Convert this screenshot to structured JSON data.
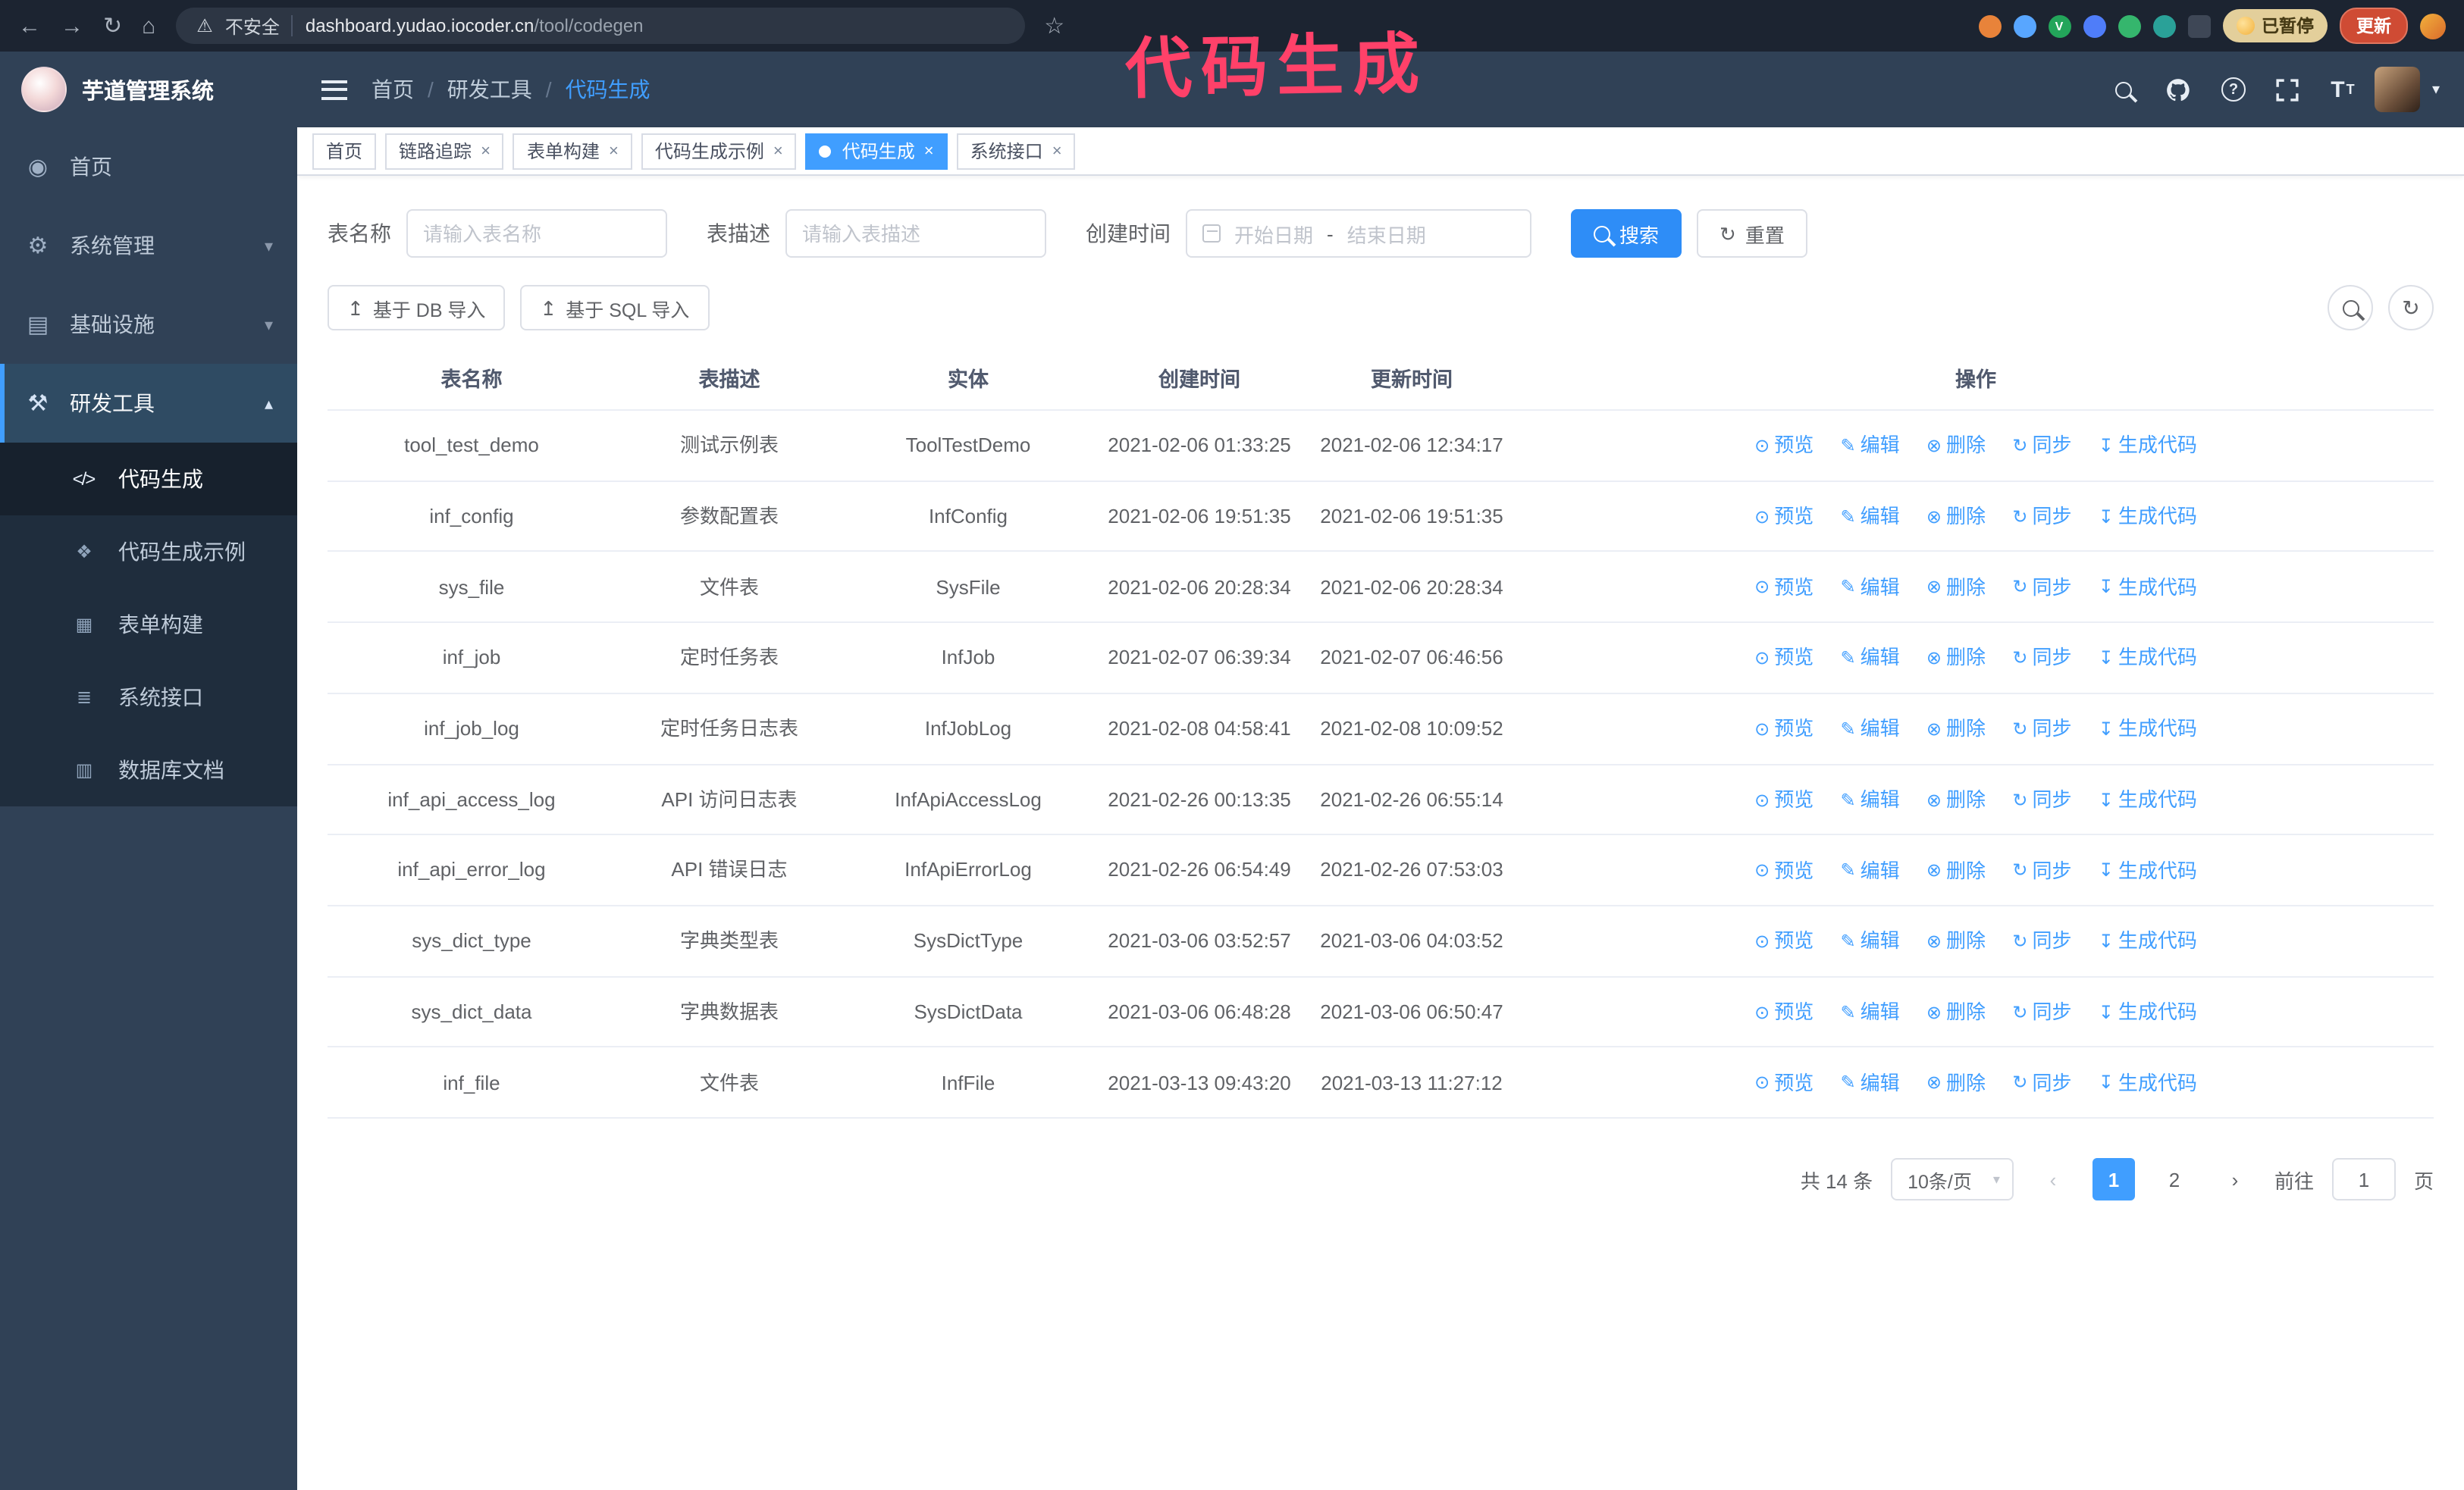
{
  "browser": {
    "security_label": "不安全",
    "url_domain": "dashboard.yudao.iocoder.cn",
    "url_path": "/tool/codegen",
    "paused_badge": "已暂停",
    "update_label": "更新"
  },
  "annotation_text": "代码生成",
  "colors": {
    "accent": "#409eff",
    "sidebar_bg": "#304156",
    "submenu_bg": "#1f2d3d",
    "annotation": "#ff4169",
    "update_button": "#cf4b34"
  },
  "sidebar": {
    "logo_title": "芋道管理系统",
    "items": [
      {
        "label": "首页"
      },
      {
        "label": "系统管理"
      },
      {
        "label": "基础设施"
      },
      {
        "label": "研发工具"
      }
    ],
    "subitems": [
      {
        "label": "代码生成"
      },
      {
        "label": "代码生成示例"
      },
      {
        "label": "表单构建"
      },
      {
        "label": "系统接口"
      },
      {
        "label": "数据库文档"
      }
    ]
  },
  "header": {
    "breadcrumb": [
      "首页",
      "研发工具",
      "代码生成"
    ]
  },
  "tabs": [
    {
      "label": "首页"
    },
    {
      "label": "链路追踪"
    },
    {
      "label": "表单构建"
    },
    {
      "label": "代码生成示例"
    },
    {
      "label": "代码生成"
    },
    {
      "label": "系统接口"
    }
  ],
  "filters": {
    "table_name_label": "表名称",
    "table_name_placeholder": "请输入表名称",
    "table_desc_label": "表描述",
    "table_desc_placeholder": "请输入表描述",
    "create_time_label": "创建时间",
    "date_start_placeholder": "开始日期",
    "date_separator": "-",
    "date_end_placeholder": "结束日期",
    "search_label": "搜索",
    "reset_label": "重置"
  },
  "toolbar": {
    "import_db_label": "基于 DB 导入",
    "import_sql_label": "基于 SQL 导入"
  },
  "table": {
    "columns": [
      "表名称",
      "表描述",
      "实体",
      "创建时间",
      "更新时间",
      "操作"
    ],
    "actions": [
      "预览",
      "编辑",
      "删除",
      "同步",
      "生成代码"
    ],
    "rows": [
      {
        "name": "tool_test_demo",
        "desc": "测试示例表",
        "entity": "ToolTestDemo",
        "created": "2021-02-06 01:33:25",
        "updated": "2021-02-06 12:34:17"
      },
      {
        "name": "inf_config",
        "desc": "参数配置表",
        "entity": "InfConfig",
        "created": "2021-02-06 19:51:35",
        "updated": "2021-02-06 19:51:35"
      },
      {
        "name": "sys_file",
        "desc": "文件表",
        "entity": "SysFile",
        "created": "2021-02-06 20:28:34",
        "updated": "2021-02-06 20:28:34"
      },
      {
        "name": "inf_job",
        "desc": "定时任务表",
        "entity": "InfJob",
        "created": "2021-02-07 06:39:34",
        "updated": "2021-02-07 06:46:56"
      },
      {
        "name": "inf_job_log",
        "desc": "定时任务日志表",
        "entity": "InfJobLog",
        "created": "2021-02-08 04:58:41",
        "updated": "2021-02-08 10:09:52"
      },
      {
        "name": "inf_api_access_log",
        "desc": "API 访问日志表",
        "entity": "InfApiAccessLog",
        "created": "2021-02-26 00:13:35",
        "updated": "2021-02-26 06:55:14"
      },
      {
        "name": "inf_api_error_log",
        "desc": "API 错误日志",
        "entity": "InfApiErrorLog",
        "created": "2021-02-26 06:54:49",
        "updated": "2021-02-26 07:53:03"
      },
      {
        "name": "sys_dict_type",
        "desc": "字典类型表",
        "entity": "SysDictType",
        "created": "2021-03-06 03:52:57",
        "updated": "2021-03-06 04:03:52"
      },
      {
        "name": "sys_dict_data",
        "desc": "字典数据表",
        "entity": "SysDictData",
        "created": "2021-03-06 06:48:28",
        "updated": "2021-03-06 06:50:47"
      },
      {
        "name": "inf_file",
        "desc": "文件表",
        "entity": "InfFile",
        "created": "2021-03-13 09:43:20",
        "updated": "2021-03-13 11:27:12"
      }
    ]
  },
  "pagination": {
    "total": "共 14 条",
    "page_size": "10条/页",
    "pages": [
      "1",
      "2"
    ],
    "goto_label": "前往",
    "goto_value": "1",
    "goto_unit": "页"
  },
  "icons": {
    "back": "←",
    "forward": "→",
    "reload": "↻",
    "home": "⌂",
    "warning": "⚠",
    "star": "☆",
    "close": "×",
    "question": "?",
    "font_size": "T",
    "caret_down": "▾",
    "chevron_down": "▾",
    "chevron_up": "▴",
    "dashboard": "◉",
    "system": "⚙",
    "infra": "▤",
    "tools": "⚒",
    "code": "</>",
    "example": "❖",
    "form": "▦",
    "api": "≣",
    "db": "▥",
    "upload": "↥",
    "refresh": "↻",
    "ext_v": "V",
    "preview": "⊙",
    "edit": "✎",
    "delete": "⊗",
    "sync": "↻",
    "generate": "↧",
    "prev": "‹",
    "next": "›"
  }
}
